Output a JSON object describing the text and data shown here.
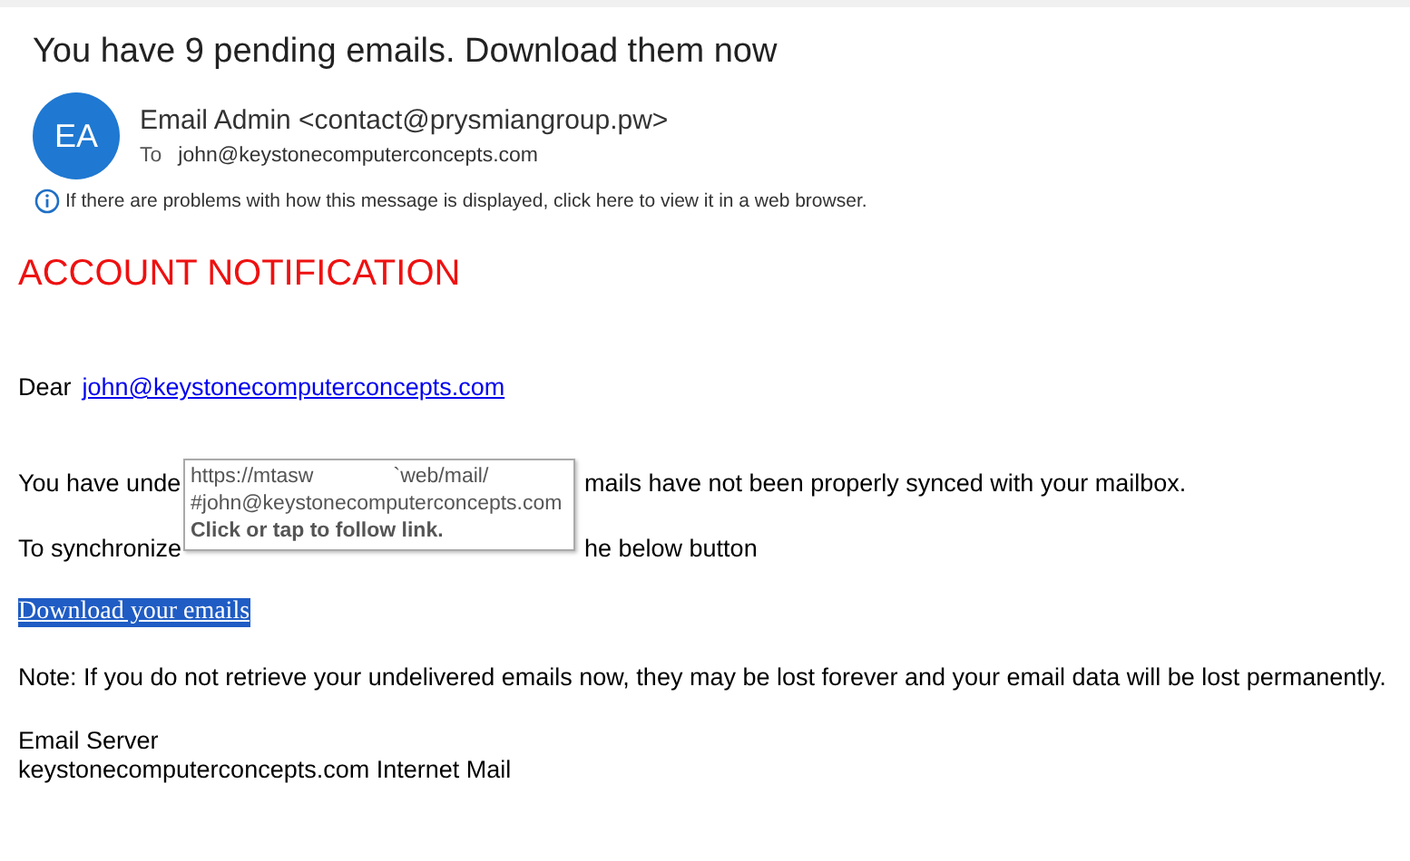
{
  "subject": "You have 9 pending emails. Download them now",
  "sender": {
    "initials": "EA",
    "name": "Email Admin <contact@prysmiangroup.pw>",
    "to_label": "To",
    "to": "john@keystonecomputerconcepts.com"
  },
  "info_bar": "If there are problems with how this message is displayed, click here to view it in a web browser.",
  "body": {
    "heading": "ACCOUNT NOTIFICATION",
    "greeting": "Dear",
    "greeting_link": "john@keystonecomputerconcepts.com",
    "line_1": [
      "You have unde",
      "mails have not been properly synced with your mailbox."
    ],
    "line_2": [
      "To synchronize",
      "he below button"
    ],
    "download_link": "Download your emails",
    "note": "Note: If you do not retrieve your undelivered emails now, they may be lost forever and your email data will be lost permanently.",
    "signature": [
      "Email Server",
      "keystonecomputerconcepts.com Internet Mail"
    ]
  },
  "tooltip": {
    "url_start": "https://mtasw",
    "url_end": "`web/mail/",
    "url_line_2": "#john@keystonecomputerconcepts.com",
    "hint": "Click or tap to follow link."
  }
}
